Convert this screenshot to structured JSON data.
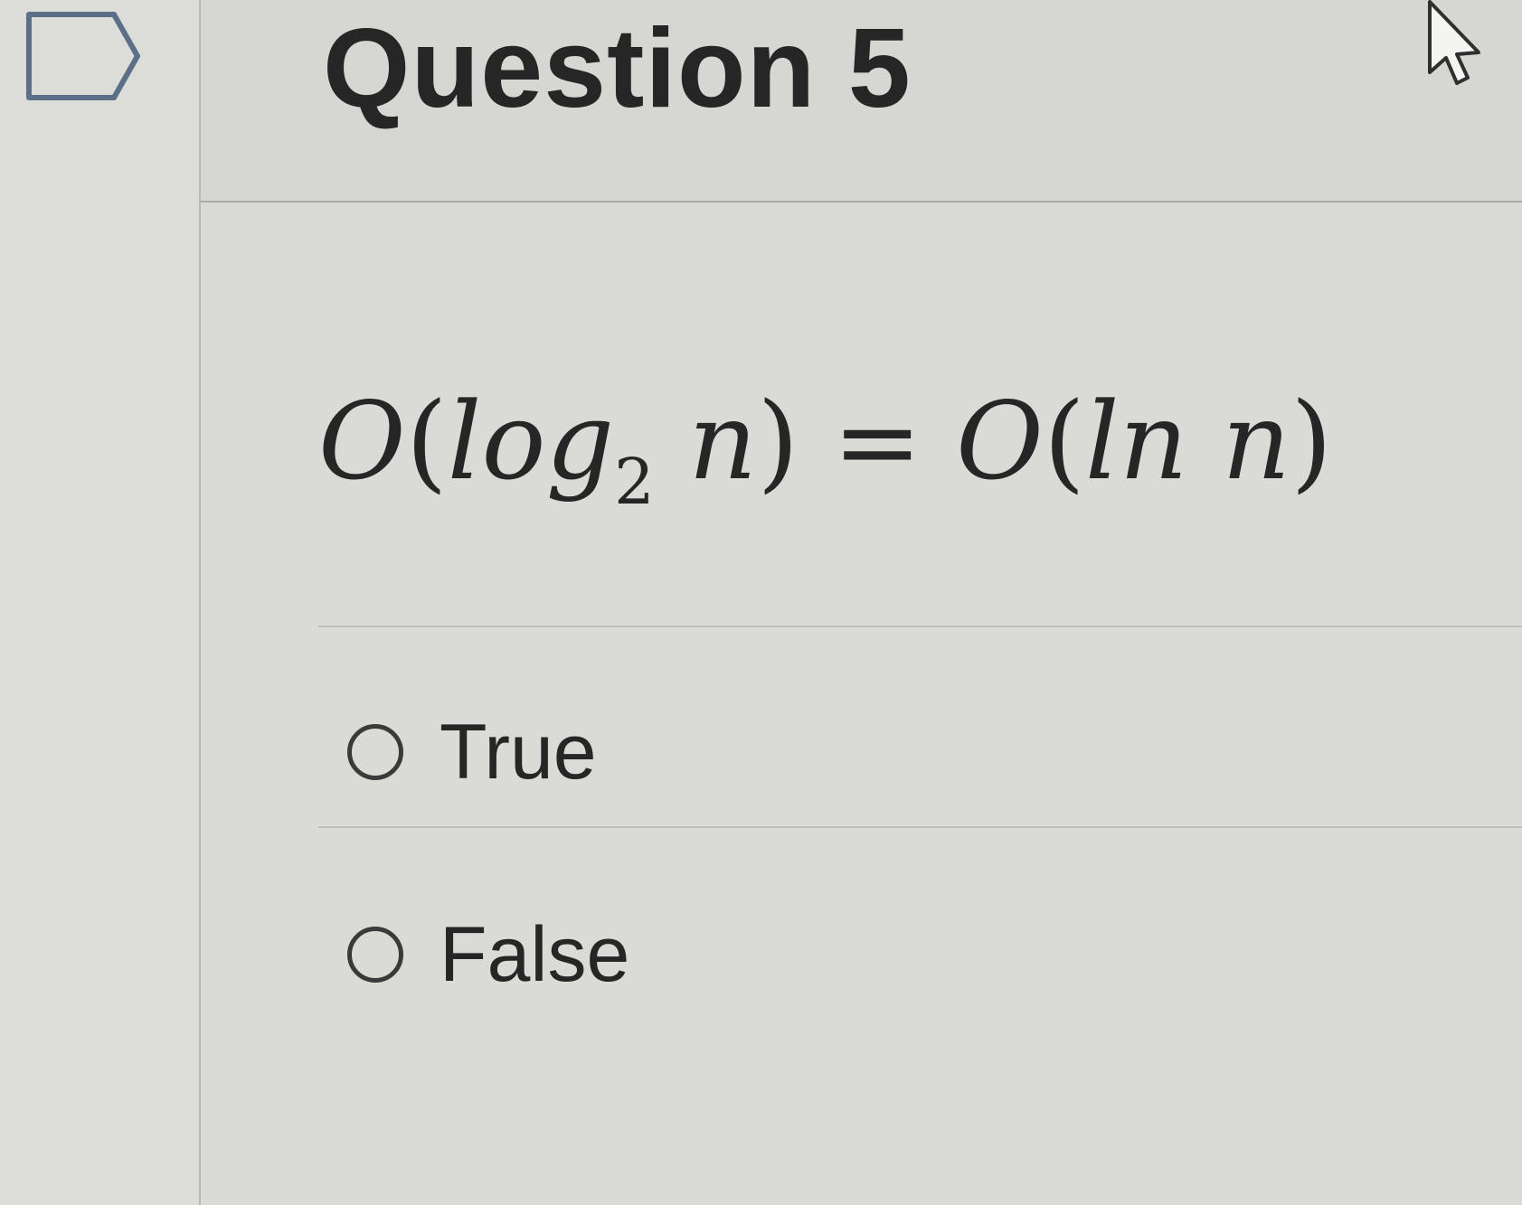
{
  "question": {
    "title": "Question 5",
    "text_parts": {
      "big_o_1": "O",
      "open_1": "(",
      "log": "log",
      "base": "2",
      "n_1": " n",
      "close_1": ")",
      "equals": " = ",
      "big_o_2": "O",
      "open_2": "(",
      "ln": "ln",
      "n_2": " n",
      "close_2": ")"
    }
  },
  "answers": [
    {
      "label": "True",
      "selected": false
    },
    {
      "label": "False",
      "selected": false
    }
  ],
  "icons": {
    "flag": "flag-icon",
    "cursor": "cursor-arrow-icon",
    "radio": "radio-button-icon"
  },
  "colors": {
    "background": "#d9d9d6",
    "text": "#262626"
  }
}
